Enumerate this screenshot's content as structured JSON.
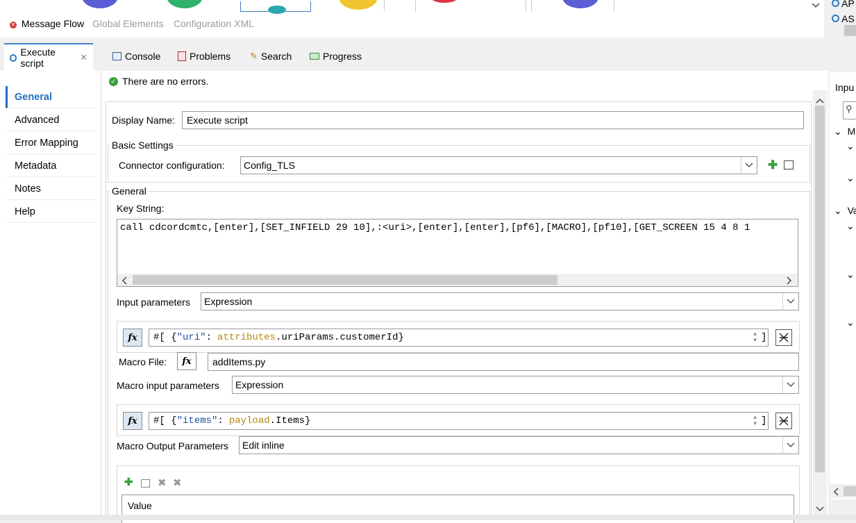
{
  "editor": {
    "tabs": [
      "Message Flow",
      "Global Elements",
      "Configuration XML"
    ]
  },
  "outline": {
    "items": [
      "AP",
      "AS"
    ]
  },
  "views": {
    "tabs": [
      {
        "label": "Execute script",
        "icon": "mule-component-icon"
      },
      {
        "label": "Console",
        "icon": "console-icon"
      },
      {
        "label": "Problems",
        "icon": "problems-icon"
      },
      {
        "label": "Search",
        "icon": "search-icon"
      },
      {
        "label": "Progress",
        "icon": "progress-icon"
      }
    ]
  },
  "nav": {
    "items": [
      "General",
      "Advanced",
      "Error Mapping",
      "Metadata",
      "Notes",
      "Help"
    ]
  },
  "status": {
    "message": "There are no errors."
  },
  "form": {
    "display_name_label": "Display Name:",
    "display_name_value": "Execute script",
    "basic_settings_title": "Basic Settings",
    "connector_label": "Connector configuration:",
    "connector_value": "Config_TLS",
    "general_title": "General",
    "key_string_label": "Key String:",
    "key_string_value": "call cdcordcmtc,[enter],[SET_INFIELD 29 10],:<uri>,[enter],[enter],[pf6],[MACRO],[pf10],[GET_SCREEN 15 4 8 1",
    "input_params_label": "Input parameters",
    "input_params_value": "Expression",
    "expr1_prefix": "#[ {",
    "expr1_key": "\"uri\"",
    "expr1_colon": ":",
    "expr1_ref": "attributes",
    "expr1_rest": ".uriParams.customerId}",
    "bracket": "]",
    "macro_file_label": "Macro File:",
    "macro_file_value": "addItems.py",
    "macro_input_label": "Macro input parameters",
    "macro_input_value": "Expression",
    "expr2_prefix": "#[ {",
    "expr2_key": "\"items\"",
    "expr2_colon": ":",
    "expr2_ref": "payload",
    "expr2_rest": ".Items}",
    "macro_output_label": "Macro Output Parameters",
    "macro_output_value": "Edit inline",
    "table_header": "Value",
    "fx_label": "fx"
  },
  "right_panel": {
    "title": "Inpu",
    "items": [
      "M",
      "Va"
    ]
  },
  "colors": {
    "accent": "#1f70c1",
    "ok_green": "#3aa03a",
    "key_blue": "#1a4fa0",
    "ref_gold": "#b8860b"
  }
}
